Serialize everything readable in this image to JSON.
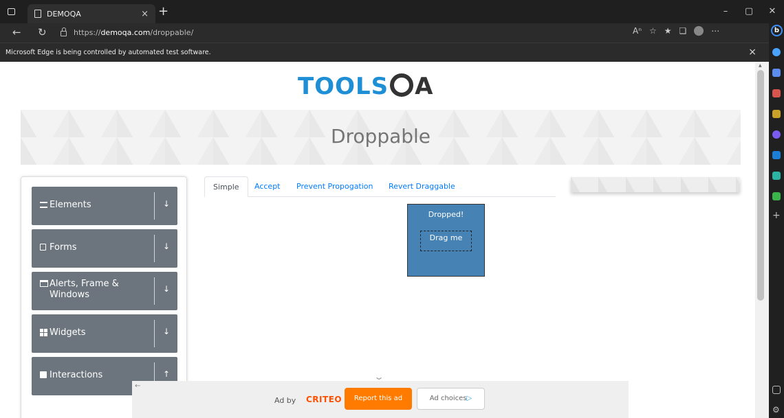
{
  "browser": {
    "tab_title": "DEMOQA",
    "url_prefix": "https://",
    "url_host": "demoqa.com",
    "url_path": "/droppable/",
    "infobar_text": "Microsoft Edge is being controlled by automated test software.",
    "new_tab_glyph": "+",
    "close_glyph": "×"
  },
  "page": {
    "logo_part1": "TOOLS",
    "logo_part2": "A",
    "banner_title": "Droppable",
    "groups": [
      {
        "label": "Elements",
        "icon": "menu-icon",
        "arrow": "↓"
      },
      {
        "label": "Forms",
        "icon": "form-icon",
        "arrow": "↓"
      },
      {
        "label": "Alerts, Frame & Windows",
        "icon": "window-icon",
        "arrow": "↓"
      },
      {
        "label": "Widgets",
        "icon": "widgets-icon",
        "arrow": "↓"
      },
      {
        "label": "Interactions",
        "icon": "interactions-icon",
        "arrow": "↑"
      }
    ],
    "tabs": [
      "Simple",
      "Accept",
      "Prevent Propogation",
      "Revert Draggable"
    ],
    "active_tab": "Simple",
    "drop_text": "Dropped!",
    "drag_text": "Drag me"
  },
  "ad": {
    "ad_by": "Ad by",
    "brand": "CRITEO",
    "report_label": "Report this ad",
    "choices_label": "Ad choices",
    "choices_glyph": "▷"
  },
  "colors": {
    "accent": "#007bff",
    "drop_box": "#4682b4",
    "group_bg": "#6c757d",
    "report_btn": "#fe7b00"
  }
}
